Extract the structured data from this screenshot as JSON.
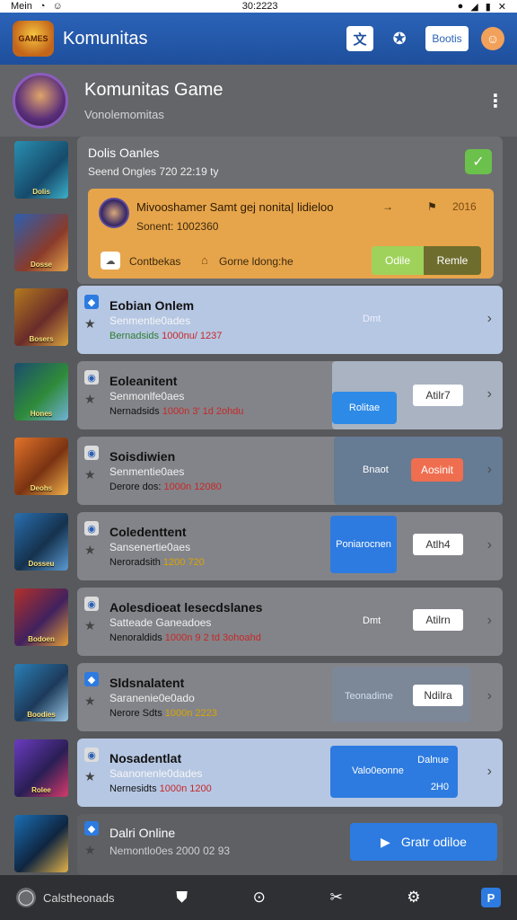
{
  "status": {
    "carrier": "Mein",
    "time": "30:2223"
  },
  "app": {
    "title": "Komunitas",
    "logo_text": "GAMES",
    "header_button": "Bootis"
  },
  "header": {
    "title": "Komunitas Game",
    "subtitle": "Vonolemomitas"
  },
  "cardA": {
    "title": "Dolis Oanles",
    "subtitle": "Seend Ongles 720 22:19 ty",
    "notification": {
      "title": "Mivooshamer Samt gej nonita| lidieloo",
      "sub": "Sonent: 1002360",
      "time": "2016",
      "chip1": "Contbekas",
      "chip2": "Gorne ldong:he",
      "btn1": "Odile",
      "btn2": "Remle"
    }
  },
  "thumbs": [
    "Dolis",
    "Dosse",
    "Bosers",
    "Hones",
    "Deohs",
    "Dosseu",
    "Bodoen",
    "Boodies",
    "Rolee"
  ],
  "rows": [
    {
      "title": "Eobian Onlem",
      "subtitle": "Senmentie0ades",
      "meta_a": "Bernadsids",
      "meta_b": "1000nu/ 1237",
      "panel_text": "Dmt",
      "button": ""
    },
    {
      "title": "Eoleanitent",
      "subtitle": "Senmonlfe0aes",
      "meta_a": "Nernadsids",
      "meta_b": "1000n 3' 1d 2ohdu",
      "panel_text": "Rolitae",
      "button": "Atilr7"
    },
    {
      "title": "Soisdiwien",
      "subtitle": "Senmentie0aes",
      "meta_a": "Derore dos:",
      "meta_b": "1000n 12080",
      "panel_text": "Bnaot",
      "button": "Aosinit"
    },
    {
      "title": "Coledenttent",
      "subtitle": "Sansenertie0aes",
      "meta_a": "Neroradsith",
      "meta_b": "1200 720",
      "panel_text": "Poniarocnen",
      "button": "Atlh4"
    },
    {
      "title": "Aolesdioeat lesecdslanes",
      "subtitle": "Satteade Ganeadoes",
      "meta_a": "Nenoraldids",
      "meta_b": "1000n 9 2 td 3ohoahd",
      "panel_text": "Dmt",
      "button": "Atilrn"
    },
    {
      "title": "Sldsnalatent",
      "subtitle": "Saranenie0e0ado",
      "meta_a": "Nerore Sdts",
      "meta_b": "1000n 2223",
      "panel_text": "Teonadime",
      "button": "Ndilra"
    },
    {
      "title": "Nosadentlat",
      "subtitle": "Saanonenle0dades",
      "meta_a": "Nernesidts",
      "meta_b": "1000n 1200",
      "panel_text": "Valo0eonne",
      "panel_top": "Dalnue",
      "panel_bottom": "2H0",
      "button": ""
    },
    {
      "title": "Dalri Online",
      "subtitle": "Nemontlo0es 2000 02 93",
      "meta_a": "",
      "meta_b": "",
      "panel_text": "",
      "button": "Gratr odiloe"
    }
  ],
  "nav": {
    "item1": "Calstheonads"
  },
  "icons": [
    "translate-icon",
    "pokeball-icon",
    "monkey-icon",
    "more-icon",
    "check-icon",
    "star-icon",
    "chevron-right-icon",
    "play-icon",
    "camera-icon",
    "shield-icon",
    "download-icon",
    "tools-icon",
    "gear-icon",
    "p-badge-icon"
  ],
  "colors": {
    "topbar": "#2b63b8",
    "notif": "#e7a54b",
    "accent": "#2d7be0",
    "orange_btn": "#ef6e4f"
  }
}
